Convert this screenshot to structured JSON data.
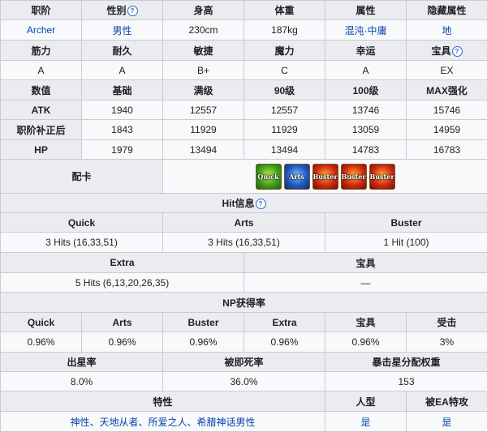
{
  "header_row": {
    "class": "职阶",
    "gender": "性别",
    "height": "身高",
    "weight": "体重",
    "attribute": "属性",
    "hidden_attribute": "隐藏属性"
  },
  "info_row": {
    "class": "Archer",
    "gender": "男性",
    "height": "230cm",
    "weight": "187kg",
    "attribute": "混沌·中庸",
    "hidden_attribute": "地"
  },
  "params_header": {
    "str": "筋力",
    "con": "耐久",
    "agi": "敏捷",
    "mp": "魔力",
    "luck": "幸运",
    "np": "宝具"
  },
  "params_values": {
    "str": "A",
    "con": "A",
    "agi": "B+",
    "mp": "C",
    "luck": "A",
    "np": "EX"
  },
  "stats_header": {
    "label": "数值",
    "base": "基础",
    "max": "满级",
    "lv90": "90级",
    "lv100": "100级",
    "maxenh": "MAX强化"
  },
  "stats_rows": [
    {
      "label": "ATK",
      "values": [
        "1940",
        "12557",
        "12557",
        "13746",
        "15746"
      ]
    },
    {
      "label": "职阶补正后",
      "values": [
        "1843",
        "11929",
        "11929",
        "13059",
        "14959"
      ]
    },
    {
      "label": "HP",
      "values": [
        "1979",
        "13494",
        "13494",
        "14783",
        "16783"
      ]
    }
  ],
  "deck": {
    "label": "配卡",
    "cards": [
      {
        "type": "quick",
        "text": "Quick"
      },
      {
        "type": "arts",
        "text": "Arts"
      },
      {
        "type": "buster",
        "text": "Buster"
      },
      {
        "type": "buster",
        "text": "Buster"
      },
      {
        "type": "buster",
        "text": "Buster"
      }
    ]
  },
  "hit_info": {
    "title": "Hit信息",
    "quick_label": "Quick",
    "arts_label": "Arts",
    "buster_label": "Buster",
    "quick_value": "3 Hits (16,33,51)",
    "arts_value": "3 Hits (16,33,51)",
    "buster_value": "1 Hit (100)",
    "extra_label": "Extra",
    "np_label": "宝具",
    "extra_value": "5 Hits (6,13,20,26,35)",
    "np_value": "—"
  },
  "np_gain": {
    "title": "NP获得率",
    "labels": [
      "Quick",
      "Arts",
      "Buster",
      "Extra",
      "宝具",
      "受击"
    ],
    "values": [
      "0.96%",
      "0.96%",
      "0.96%",
      "0.96%",
      "0.96%",
      "3%"
    ]
  },
  "star": {
    "gen_label": "出星率",
    "death_label": "被即死率",
    "weight_label": "暴击星分配权重",
    "gen_value": "8.0%",
    "death_value": "36.0%",
    "weight_value": "153"
  },
  "traits": {
    "label": "特性",
    "humanoid_label": "人型",
    "ea_label": "被EA特攻",
    "value": "神性、天地从者、所爱之人、希腊神话男性",
    "humanoid_value": "是",
    "ea_value": "是"
  }
}
